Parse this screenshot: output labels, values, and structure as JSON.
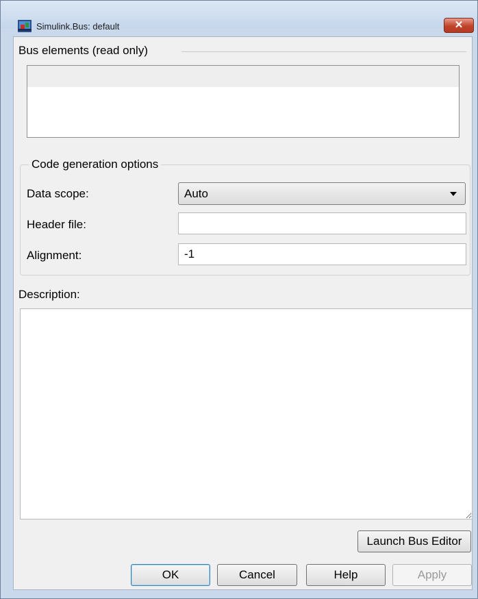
{
  "window": {
    "title": "Simulink.Bus: default",
    "close_glyph": "✕"
  },
  "bus_elements": {
    "legend": "Bus elements (read only)"
  },
  "code_generation": {
    "legend": "Code generation options",
    "data_scope": {
      "label": "Data scope:",
      "value": "Auto"
    },
    "header_file": {
      "label": "Header file:",
      "value": ""
    },
    "alignment": {
      "label": "Alignment:",
      "value": "-1"
    }
  },
  "description": {
    "label": "Description:",
    "value": ""
  },
  "buttons": {
    "launch_bus_editor": "Launch Bus Editor",
    "ok": "OK",
    "cancel": "Cancel",
    "help": "Help",
    "apply": "Apply"
  },
  "icons": {
    "app": "simulink-bus-icon",
    "close": "close-icon",
    "dropdown": "chevron-down-icon"
  },
  "colors": {
    "window_frame": "#c9d8ea",
    "close_button": "#c0442b",
    "ok_focus": "#3c7fb1"
  }
}
